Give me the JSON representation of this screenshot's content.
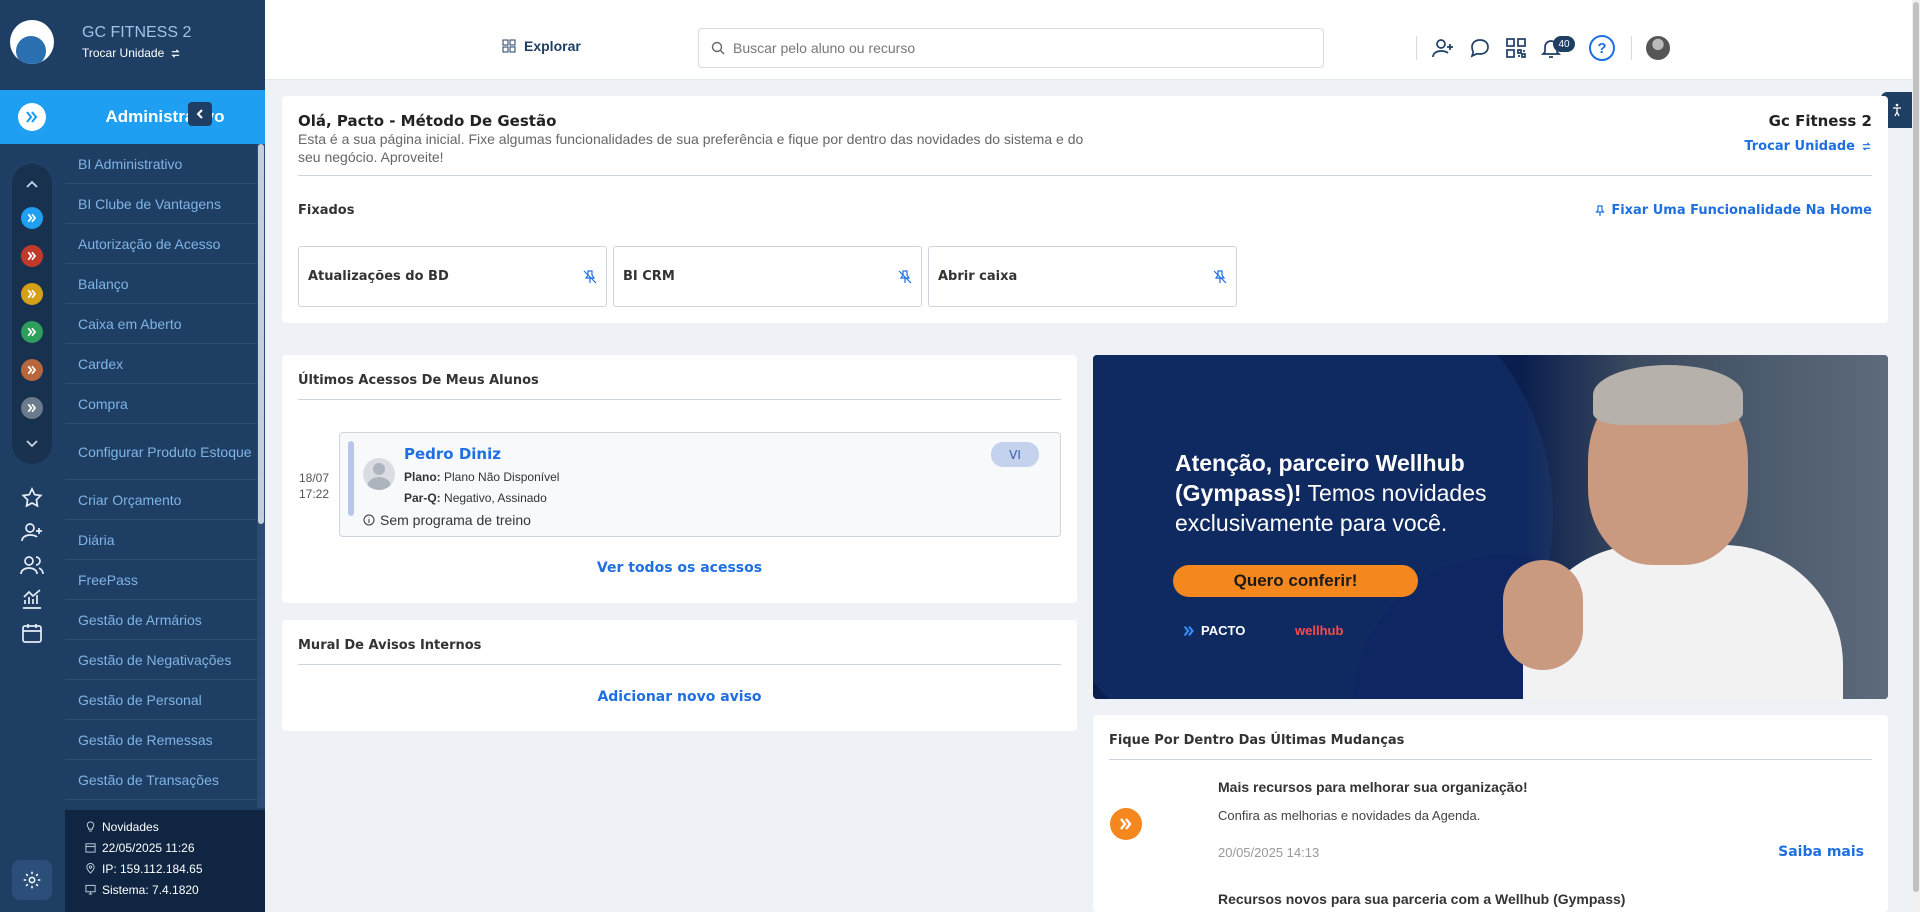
{
  "sidebar": {
    "unit_name": "GC FITNESS 2",
    "unit_switch": "Trocar Unidade",
    "module_title": "Administrativo",
    "menu": [
      "BI Administrativo",
      "BI Clube de Vantagens",
      "Autorização de Acesso",
      "Balanço",
      "Caixa em Aberto",
      "Cardex",
      "Compra",
      "Configurar Produto Estoque",
      "Criar Orçamento",
      "Diária",
      "FreePass",
      "Gestão de Armários",
      "Gestão de Negativações",
      "Gestão de Personal",
      "Gestão de Remessas",
      "Gestão de Transações"
    ],
    "footer": {
      "news": "Novidades",
      "datetime": "22/05/2025 11:26",
      "ip": "IP: 159.112.184.65",
      "system": "Sistema: 7.4.1820"
    },
    "module_colors": [
      "#1e9ff2",
      "#c0392b",
      "#d4a017",
      "#2e9e5b",
      "#b8663b",
      "#6b7a8c"
    ]
  },
  "topbar": {
    "explore_label": "Explorar",
    "search_placeholder": "Buscar pelo aluno ou recurso",
    "notifications_count": "40",
    "help_label": "?"
  },
  "welcome": {
    "greeting": "Olá, Pacto - Método De Gestão",
    "intro": "Esta é a sua página inicial. Fixe algumas funcionalidades de sua preferência e fique por dentro das novidades do sistema e do seu negócio. Aproveite!",
    "unit_name": "Gc Fitness 2",
    "unit_switch": "Trocar Unidade",
    "pinned_title": "Fixados",
    "pin_link": "Fixar Uma Funcionalidade Na Home",
    "pinned": [
      "Atualizações do BD",
      "BI CRM",
      "Abrir caixa"
    ]
  },
  "access": {
    "title": "Últimos Acessos De Meus Alunos",
    "date": "18/07",
    "time": "17:22",
    "student_name": "Pedro Diniz",
    "plan_label": "Plano:",
    "plan_value": "Plano Não Disponível",
    "parq_label": "Par-Q:",
    "parq_value": "Negativo, Assinado",
    "no_program": "Sem programa de treino",
    "badge": "VI",
    "see_all": "Ver todos os acessos"
  },
  "mural": {
    "title": "Mural De Avisos Internos",
    "add": "Adicionar novo aviso"
  },
  "banner": {
    "headline_bold": "Atenção, parceiro Wellhub (Gympass)!",
    "headline_light": " Temos novidades exclusivamente para você.",
    "cta": "Quero conferir!",
    "logo_pacto": "PACTO",
    "logo_wellhub": "wellhub"
  },
  "news": {
    "title": "Fique Por Dentro Das Últimas Mudanças",
    "item1_title": "Mais recursos para melhorar sua organização!",
    "item1_desc": "Confira as melhorias e novidades da Agenda.",
    "item1_date": "20/05/2025 14:13",
    "item1_more": "Saiba mais",
    "item2_title": "Recursos novos para sua parceria com a Wellhub (Gympass)"
  }
}
